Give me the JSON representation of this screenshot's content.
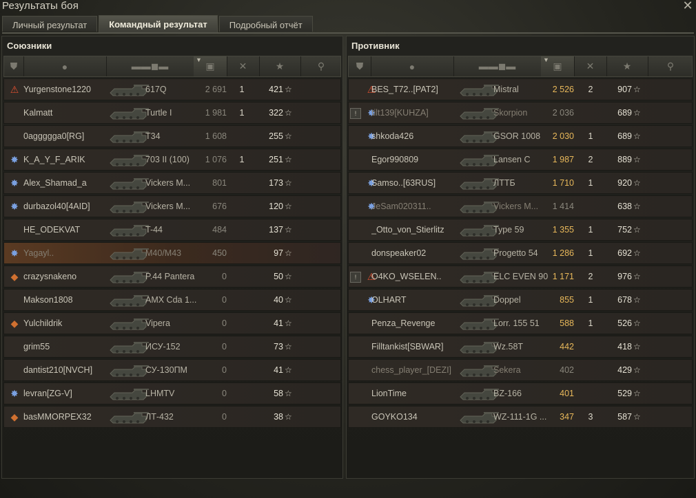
{
  "window": {
    "title": "Результаты боя"
  },
  "tabs": [
    {
      "label": "Личный результат",
      "active": false
    },
    {
      "label": "Командный результат",
      "active": true
    },
    {
      "label": "Подробный отчёт",
      "active": false
    }
  ],
  "allies": {
    "title": "Союзники",
    "rows": [
      {
        "player": "Yurgenstone1220",
        "tank": "617Q",
        "damage": "2 691",
        "kills": "1",
        "xp": "421",
        "badge": "warning-icon",
        "dead": false,
        "mine": false
      },
      {
        "player": "Kalmatt",
        "tank": "Turtle I",
        "damage": "1 981",
        "kills": "1",
        "xp": "322",
        "badge": "",
        "dead": false,
        "mine": false
      },
      {
        "player": "0aggggga0[RG]",
        "tank": "T34",
        "damage": "1 608",
        "kills": "",
        "xp": "255",
        "badge": "",
        "dead": false,
        "mine": false
      },
      {
        "player": "K_A_Y_F_ARIK",
        "tank": "703 II (100)",
        "damage": "1 076",
        "kills": "1",
        "xp": "251",
        "badge": "emblem-icon",
        "dead": false,
        "mine": false
      },
      {
        "player": "Alex_Shamad_a",
        "tank": "Vickers M...",
        "damage": "801",
        "kills": "",
        "xp": "173",
        "badge": "emblem-icon",
        "dead": false,
        "mine": false
      },
      {
        "player": "durbazol40[4AID]",
        "tank": "Vickers M...",
        "damage": "676",
        "kills": "",
        "xp": "120",
        "badge": "emblem-icon",
        "dead": false,
        "mine": false
      },
      {
        "player": "HE_ODEKVAT",
        "tank": "T-44",
        "damage": "484",
        "kills": "",
        "xp": "137",
        "badge": "",
        "dead": false,
        "mine": false
      },
      {
        "player": "Yagayl..",
        "tank": "M40/M43",
        "damage": "450",
        "kills": "",
        "xp": "97",
        "badge": "emblem-icon",
        "dead": true,
        "mine": true
      },
      {
        "player": "crazysnakeno",
        "tank": "P.44 Pantera",
        "damage": "0",
        "kills": "",
        "xp": "50",
        "badge": "rank-icon",
        "dead": false,
        "mine": false
      },
      {
        "player": "Makson1808",
        "tank": "AMX Cda 1...",
        "damage": "0",
        "kills": "",
        "xp": "40",
        "badge": "",
        "dead": false,
        "mine": false
      },
      {
        "player": "Yulchildrik",
        "tank": "Vipera",
        "damage": "0",
        "kills": "",
        "xp": "41",
        "badge": "rank-icon",
        "dead": false,
        "mine": false
      },
      {
        "player": "grim55",
        "tank": "ИСУ-152",
        "damage": "0",
        "kills": "",
        "xp": "73",
        "badge": "",
        "dead": false,
        "mine": false
      },
      {
        "player": "dantist210[NVCH]",
        "tank": "СУ-130ПМ",
        "damage": "0",
        "kills": "",
        "xp": "41",
        "badge": "",
        "dead": false,
        "mine": false
      },
      {
        "player": "levran[ZG-V]",
        "tank": "LHMTV",
        "damage": "0",
        "kills": "",
        "xp": "58",
        "badge": "emblem-icon",
        "dead": false,
        "mine": false
      },
      {
        "player": "basMMORPEX32",
        "tank": "ЛТ-432",
        "damage": "0",
        "kills": "",
        "xp": "38",
        "badge": "rank-icon",
        "dead": false,
        "mine": false
      }
    ]
  },
  "enemies": {
    "title": "Противник",
    "rows": [
      {
        "player": "BES_T72..[PAT2]",
        "tank": "Mistral",
        "damage": "2 526",
        "kills": "2",
        "xp": "907",
        "badge": "warning-icon",
        "prefix": "",
        "dead": false
      },
      {
        "player": "tilt139[KUHZA]",
        "tank": "Skorpion",
        "damage": "2 036",
        "kills": "",
        "xp": "689",
        "badge": "emblem-icon",
        "prefix": "!",
        "dead": true
      },
      {
        "player": "shkoda426",
        "tank": "GSOR 1008",
        "damage": "2 030",
        "kills": "1",
        "xp": "689",
        "badge": "emblem-icon",
        "prefix": "",
        "dead": false
      },
      {
        "player": "Egor990809",
        "tank": "Lansen C",
        "damage": "1 987",
        "kills": "2",
        "xp": "889",
        "badge": "",
        "prefix": "",
        "dead": false
      },
      {
        "player": "Samso..[63RUS]",
        "tank": "ЛТТБ",
        "damage": "1 710",
        "kills": "1",
        "xp": "920",
        "badge": "emblem-icon",
        "prefix": "",
        "dead": false
      },
      {
        "player": "JeSam020311..",
        "tank": "Vickers M...",
        "damage": "1 414",
        "kills": "",
        "xp": "638",
        "badge": "emblem-icon",
        "prefix": "",
        "dead": true
      },
      {
        "player": "_Otto_von_Stierlitz",
        "tank": "Type 59",
        "damage": "1 355",
        "kills": "1",
        "xp": "752",
        "badge": "",
        "prefix": "",
        "dead": false
      },
      {
        "player": "donspeaker02",
        "tank": "Progetto 54",
        "damage": "1 286",
        "kills": "1",
        "xp": "692",
        "badge": "",
        "prefix": "",
        "dead": false
      },
      {
        "player": "O4KO_WSELEN..",
        "tank": "ELC EVEN 90",
        "damage": "1 171",
        "kills": "2",
        "xp": "976",
        "badge": "warning-icon",
        "prefix": "!",
        "dead": false
      },
      {
        "player": "OLHART",
        "tank": "Doppel",
        "damage": "855",
        "kills": "1",
        "xp": "678",
        "badge": "emblem-icon",
        "prefix": "",
        "dead": false
      },
      {
        "player": "Penza_Revenge",
        "tank": "Lorr. 155 51",
        "damage": "588",
        "kills": "1",
        "xp": "526",
        "badge": "",
        "prefix": "",
        "dead": false
      },
      {
        "player": "Filltankist[SBWAR]",
        "tank": "Wz.58T",
        "damage": "442",
        "kills": "",
        "xp": "418",
        "badge": "",
        "prefix": "",
        "dead": false
      },
      {
        "player": "chess_player_[DEZI]",
        "tank": "Sekera",
        "damage": "402",
        "kills": "",
        "xp": "429",
        "badge": "",
        "prefix": "",
        "dead": true
      },
      {
        "player": "LionTime",
        "tank": "BZ-166",
        "damage": "401",
        "kills": "",
        "xp": "529",
        "badge": "",
        "prefix": "",
        "dead": false
      },
      {
        "player": "GOYKO134",
        "tank": "WZ-111-1G ...",
        "damage": "347",
        "kills": "3",
        "xp": "587",
        "badge": "",
        "prefix": "",
        "dead": false
      }
    ]
  },
  "colors": {
    "accent": "#e8b85a",
    "mine_row": "#5a3a22",
    "warning": "#d03020"
  }
}
